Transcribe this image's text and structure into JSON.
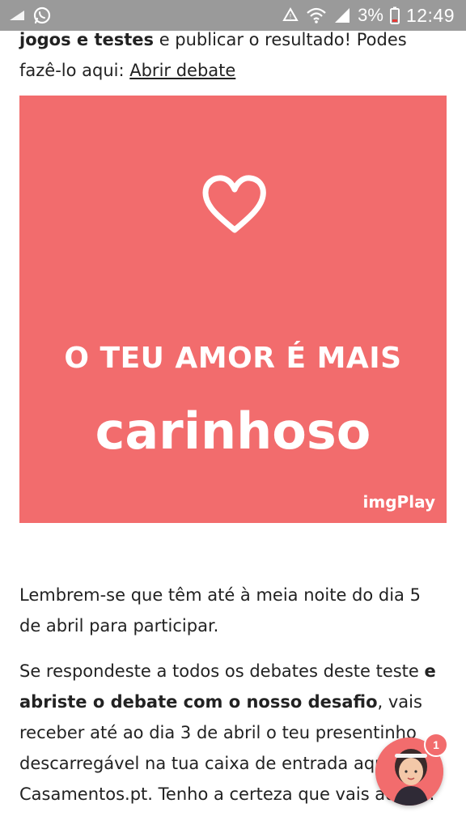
{
  "status_bar": {
    "battery": "3%",
    "time": "12:49",
    "icons": [
      "signal-icon",
      "whatsapp-icon",
      "data-saver-icon",
      "wifi-icon",
      "cell-signal-icon",
      "battery-low-icon"
    ]
  },
  "intro": {
    "bold_part": "jogos e testes",
    "text_part": " e publicar o resultado! Podes fazê-lo aqui: ",
    "link_label": "Abrir debate"
  },
  "banner": {
    "line1": "O TEU AMOR É MAIS",
    "line2": "carinhoso",
    "brand": "imgPlay",
    "background_color": "#f26c6d"
  },
  "paragraph1": {
    "text": "Lembrem-se que têm até à meia noite do dia 5 de abril para participar."
  },
  "paragraph2": {
    "text_a": "Se respondeste a todos os debates deste teste ",
    "bold_part": "e abriste o debate com o nosso desafio",
    "text_b": ", vais receber até ao dia 3 de abril o teu presentinho descarregável na tua caixa de entrada aqui de Casamentos.pt. Tenho a certeza que vais adorar."
  },
  "assistant": {
    "badge_count": "1"
  }
}
